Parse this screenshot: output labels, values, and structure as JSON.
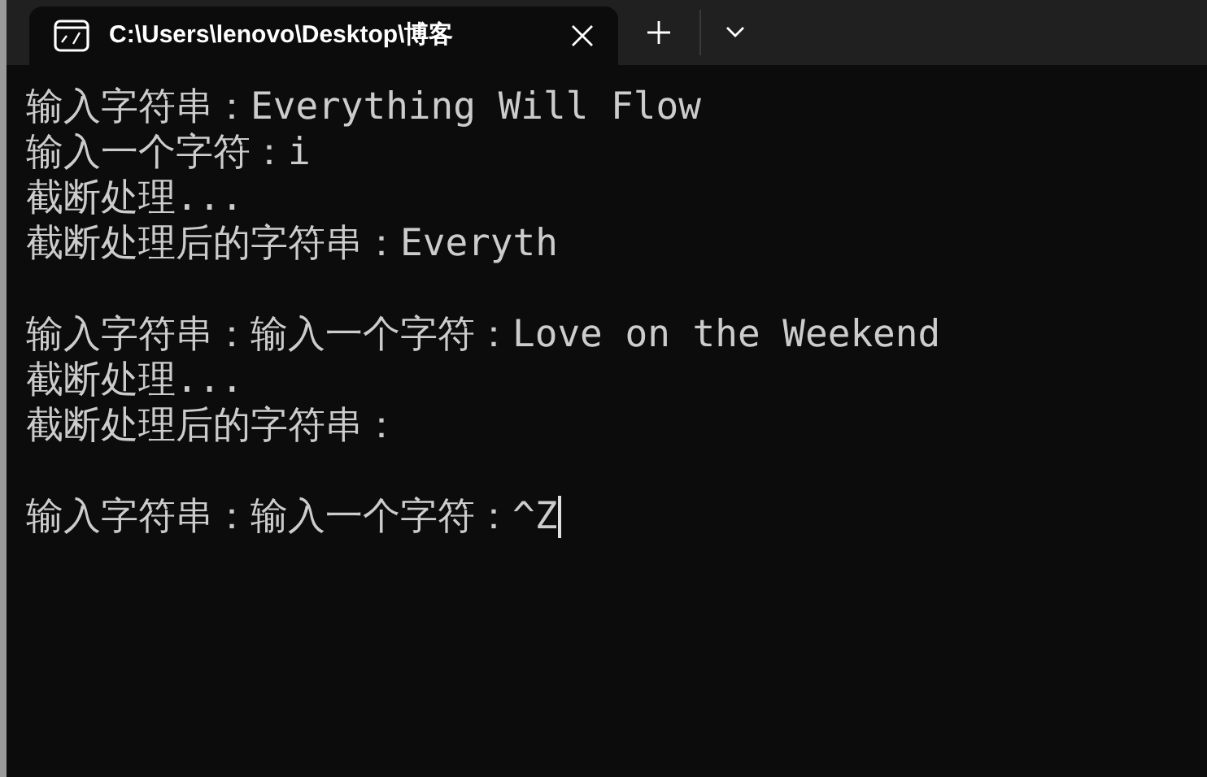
{
  "window": {
    "tabs": [
      {
        "title": "C:\\Users\\lenovo\\Desktop\\博客",
        "selected": true
      }
    ]
  },
  "terminal": {
    "blocks": [
      {
        "lines": [
          "输入字符串：Everything Will Flow",
          "输入一个字符：i",
          "截断处理...",
          "截断处理后的字符串：Everyth"
        ]
      },
      {
        "lines": [
          "输入字符串：输入一个字符：Love on the Weekend",
          "截断处理...",
          "截断处理后的字符串："
        ]
      },
      {
        "lines": [
          "输入字符串：输入一个字符：^Z"
        ]
      }
    ],
    "cursor_visible": true
  }
}
